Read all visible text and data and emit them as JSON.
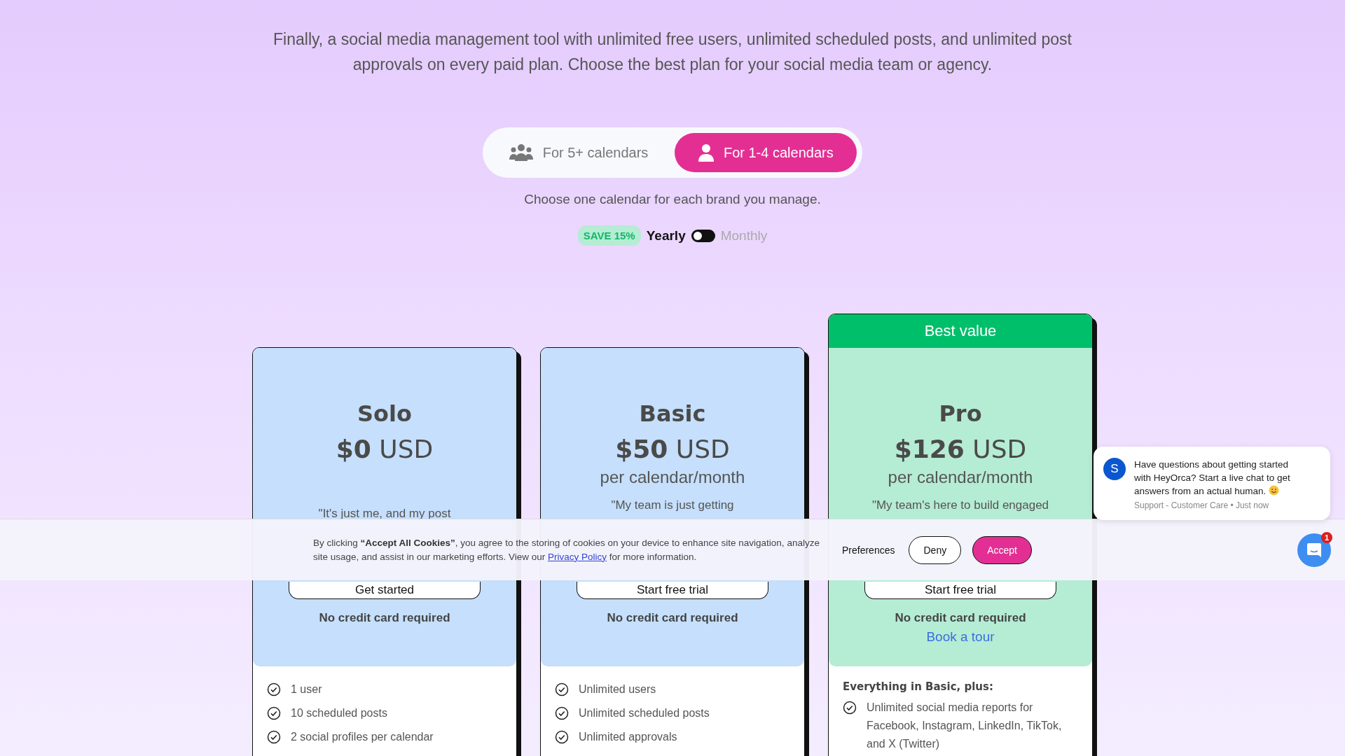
{
  "subtitle": "Finally, a social media management tool with unlimited free users, unlimited scheduled posts, and unlimited post approvals on every paid plan. Choose the best plan for your social media team or agency.",
  "audience_tabs": [
    {
      "label": "For 5+ calendars",
      "kind": "group",
      "selected": false
    },
    {
      "label": "For 1-4 calendars",
      "kind": "person",
      "selected": true
    }
  ],
  "hint": "Choose one calendar for each brand you manage.",
  "billing": {
    "badge": "SAVE 15%",
    "options": [
      {
        "label": "Yearly",
        "selected": true
      },
      {
        "label": "Monthly",
        "selected": false
      }
    ]
  },
  "plans": [
    {
      "name": "Solo",
      "price": "$0",
      "currency": "USD",
      "quote": "\"It's just me, and my post",
      "button": "Get started",
      "note": "No credit card required",
      "color": "#c5dffc",
      "features": [
        "1 user",
        "10 scheduled posts",
        "2 social profiles per calendar"
      ]
    },
    {
      "name": "Basic",
      "price": "$50",
      "currency": "USD",
      "period": "per calendar/month",
      "quote": "\"My team is just getting",
      "button": "Start free trial",
      "note": "No credit card required",
      "color": "#c5dffc",
      "features": [
        "Unlimited users",
        "Unlimited scheduled posts",
        "Unlimited approvals"
      ]
    },
    {
      "name": "Pro",
      "badge": "Best value",
      "price": "$126",
      "currency": "USD",
      "period": "per calendar/month",
      "quote": "\"My team's here to build engaged",
      "button": "Start free trial",
      "note": "No credit card required",
      "link": "Book a tour",
      "color": "#b5ecd4",
      "features_heading": "Everything in Basic, plus:",
      "features": [
        "Unlimited social media reports for Facebook, Instagram, LinkedIn, TikTok, and X (Twitter)"
      ]
    }
  ],
  "cookie_banner": {
    "text": "By clicking **“Accept All Cookies”**, you agree to the storing of cookies on your device to enhance site navigation, analyze site usage, and assist in our marketing efforts. View our ",
    "link": "Privacy Policy",
    "text_after": " for more information.",
    "buttons": [
      {
        "label": "Preferences",
        "kind": "plain"
      },
      {
        "label": "Deny",
        "kind": "outline"
      },
      {
        "label": "Accept",
        "kind": "primary"
      }
    ]
  },
  "chat": {
    "avatar": "S",
    "message": "Have questions about getting started with HeyOrca? Start a live chat to get answers from an actual human.",
    "meta": "Support - Customer Care • Just now",
    "unread": "1"
  }
}
